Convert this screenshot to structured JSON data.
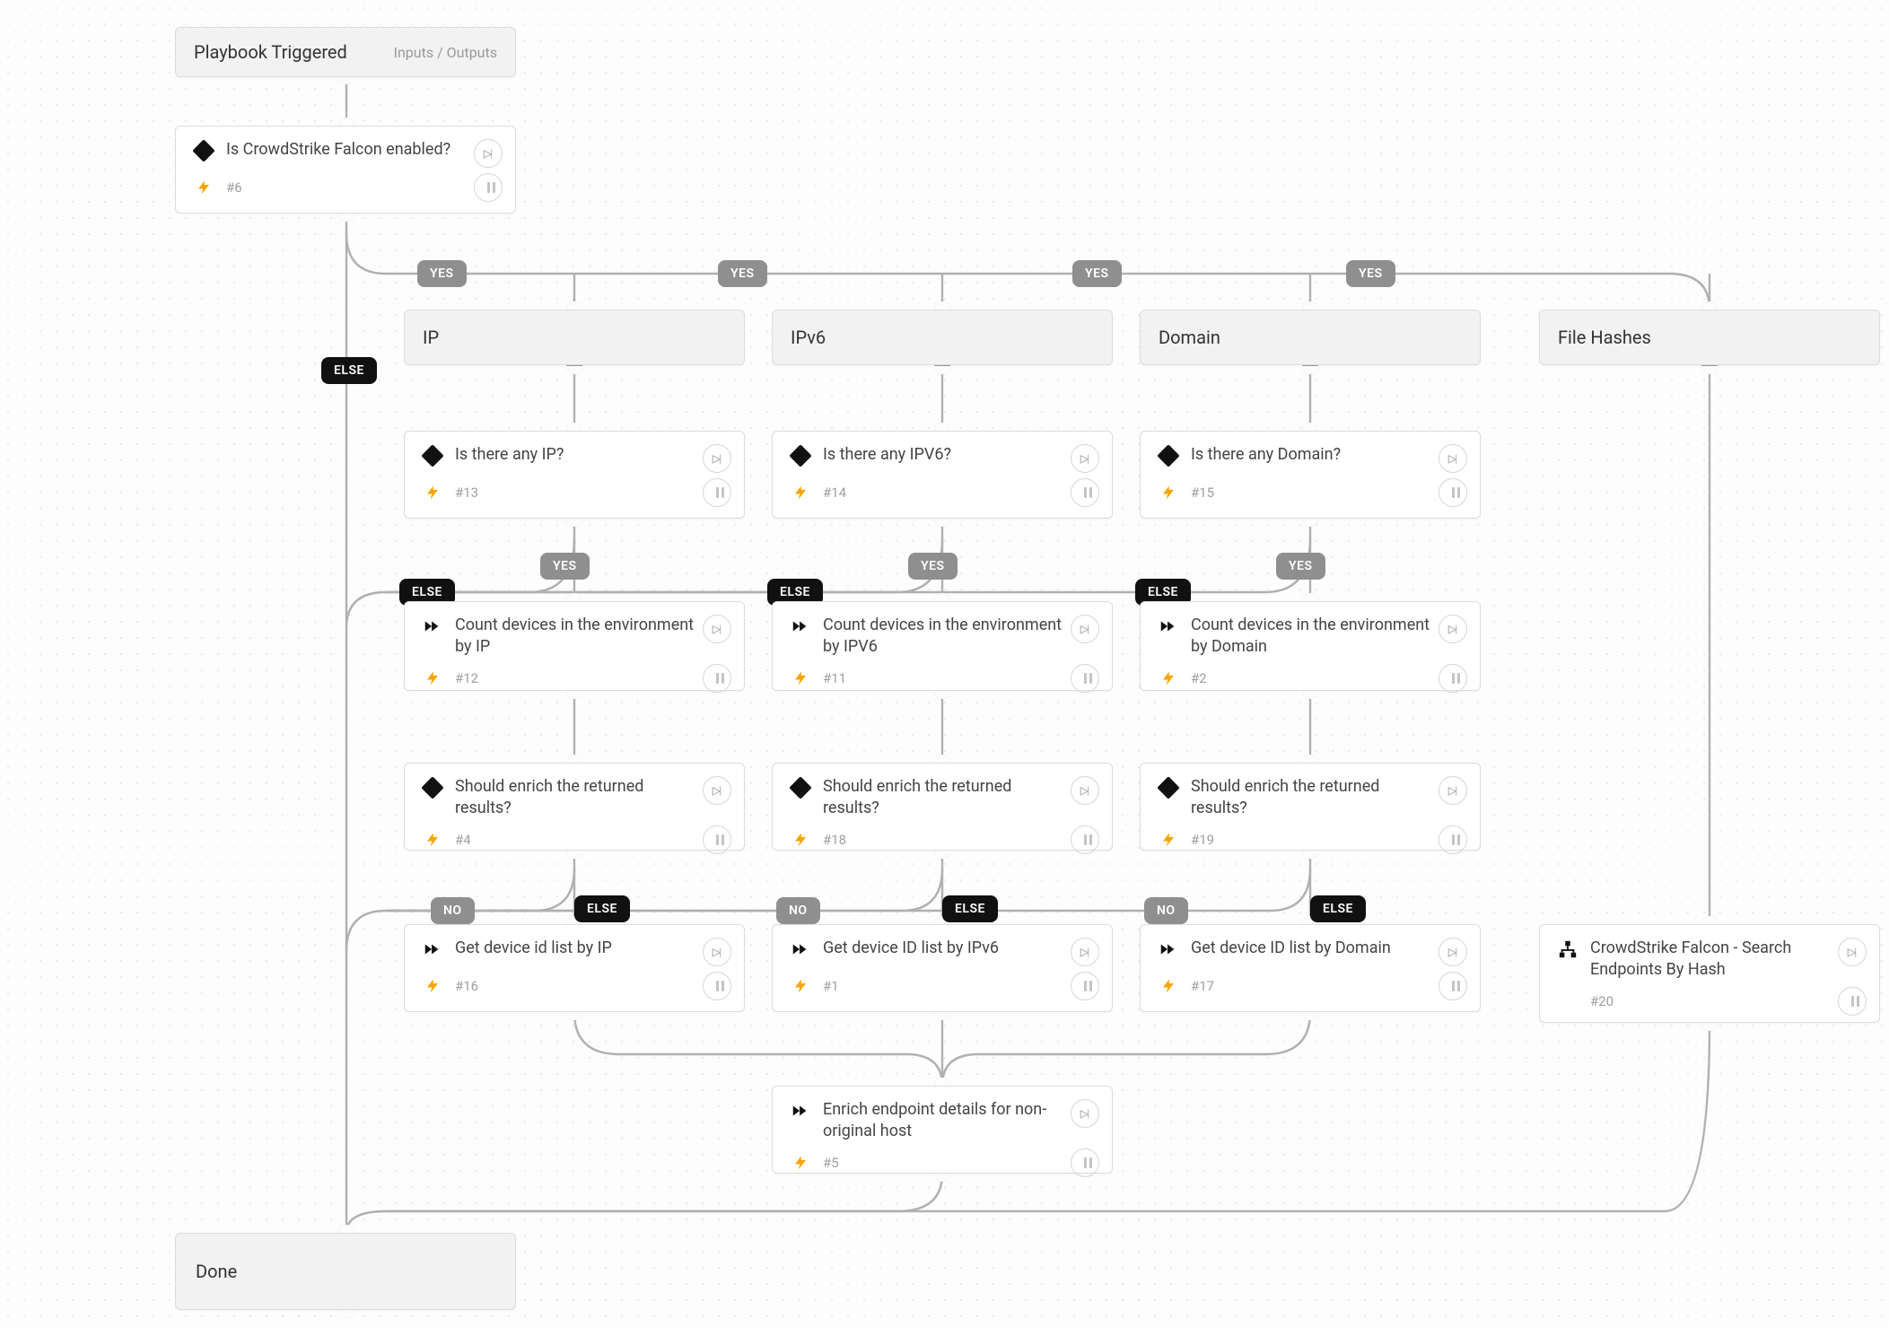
{
  "labels": {
    "yes": "YES",
    "no": "NO",
    "else": "ELSE",
    "inputs_outputs": "Inputs / Outputs"
  },
  "trigger": {
    "title": "Playbook Triggered"
  },
  "done": {
    "title": "Done"
  },
  "sections": {
    "ip": "IP",
    "ipv6": "IPv6",
    "domain": "Domain",
    "file_hashes": "File Hashes"
  },
  "tasks": {
    "t6": {
      "title": "Is CrowdStrike Falcon enabled?",
      "tag": "#6",
      "kind": "cond"
    },
    "t13": {
      "title": "Is there any IP?",
      "tag": "#13",
      "kind": "cond"
    },
    "t14": {
      "title": "Is there any IPV6?",
      "tag": "#14",
      "kind": "cond"
    },
    "t15": {
      "title": "Is there any Domain?",
      "tag": "#15",
      "kind": "cond"
    },
    "t12": {
      "title": "Count devices in the environment by IP",
      "tag": "#12",
      "kind": "action"
    },
    "t11": {
      "title": "Count devices in the environment by IPV6",
      "tag": "#11",
      "kind": "action"
    },
    "t2": {
      "title": "Count devices in the environment by Domain",
      "tag": "#2",
      "kind": "action"
    },
    "t4": {
      "title": "Should enrich the returned results?",
      "tag": "#4",
      "kind": "cond"
    },
    "t18": {
      "title": "Should enrich the returned results?",
      "tag": "#18",
      "kind": "cond"
    },
    "t19": {
      "title": "Should enrich the returned results?",
      "tag": "#19",
      "kind": "cond"
    },
    "t16": {
      "title": "Get device id list by IP",
      "tag": "#16",
      "kind": "action"
    },
    "t1": {
      "title": "Get device ID list by IPv6",
      "tag": "#1",
      "kind": "action"
    },
    "t17": {
      "title": "Get device ID list by Domain",
      "tag": "#17",
      "kind": "action"
    },
    "t20": {
      "title": "CrowdStrike Falcon - Search Endpoints By Hash",
      "tag": "#20",
      "kind": "tree"
    },
    "t5": {
      "title": "Enrich endpoint details for non-original host",
      "tag": "#5",
      "kind": "action"
    }
  }
}
